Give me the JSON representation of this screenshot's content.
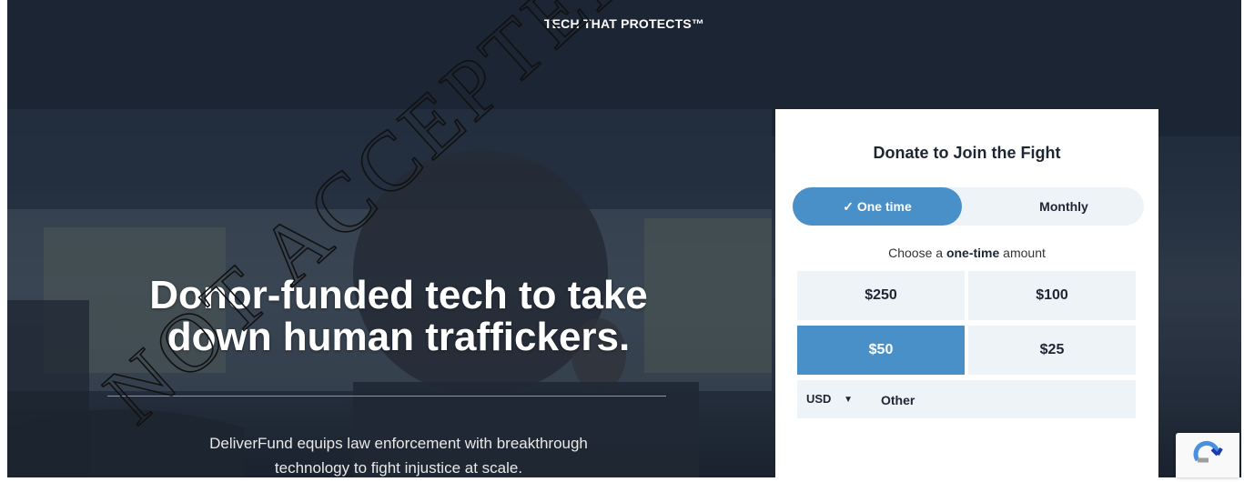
{
  "hero": {
    "tagline": "TECH THAT PROTECTS™",
    "headline_line1": "Donor-funded tech to take",
    "headline_line2": "down human traffickers.",
    "subtext_line1": "DeliverFund equips law enforcement with breakthrough",
    "subtext_line2": "technology to fight injustice at scale."
  },
  "donate": {
    "title": "Donate to Join the Fight",
    "frequency": {
      "one_time_check": "✓",
      "one_time_label": "One time",
      "monthly_label": "Monthly",
      "selected": "One time"
    },
    "choose_prefix": "Choose a",
    "choose_bold": "one-time",
    "choose_suffix": "amount",
    "amounts": [
      "$250",
      "$100",
      "$50",
      "$25"
    ],
    "selected_amount": "$50",
    "currency": "USD",
    "other_placeholder": "Other"
  },
  "watermark": {
    "text": "NOT ACCEPTED"
  },
  "colors": {
    "accent": "#4a90c8",
    "option_bg": "#eef3f8",
    "divider": "#b8962e",
    "text_dark": "#1e2633"
  },
  "icons": {
    "recaptcha": "recaptcha-icon",
    "currency_caret": "caret-down-icon"
  }
}
